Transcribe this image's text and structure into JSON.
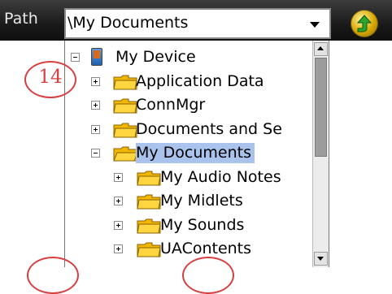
{
  "topbar": {
    "path_label": "Path",
    "path_value": "\\My Documents",
    "up_icon": "folder-up-icon"
  },
  "tree": {
    "items": [
      {
        "label": "My Device",
        "level": 0,
        "expander": "minus",
        "icon": "device-icon",
        "selected": false
      },
      {
        "label": "Application Data",
        "level": 1,
        "expander": "plus",
        "icon": "folder-icon",
        "selected": false
      },
      {
        "label": "ConnMgr",
        "level": 1,
        "expander": "plus",
        "icon": "folder-icon",
        "selected": false
      },
      {
        "label": "Documents and Se",
        "level": 1,
        "expander": "plus",
        "icon": "folder-icon",
        "selected": false
      },
      {
        "label": "My Documents",
        "level": 1,
        "expander": "minus",
        "icon": "folder-open-icon",
        "selected": true
      },
      {
        "label": "My Audio Notes",
        "level": 2,
        "expander": "plus",
        "icon": "folder-icon",
        "selected": false
      },
      {
        "label": "My Midlets",
        "level": 2,
        "expander": "plus",
        "icon": "folder-icon",
        "selected": false
      },
      {
        "label": "My Sounds",
        "level": 2,
        "expander": "plus",
        "icon": "folder-icon",
        "selected": false
      },
      {
        "label": "UAContents",
        "level": 2,
        "expander": "plus",
        "icon": "folder-icon",
        "selected": false
      }
    ]
  },
  "annotations": {
    "callout_14": "14"
  },
  "colors": {
    "selection": "#a9c3ec",
    "callout": "#d64040",
    "folder": "#f2b800"
  }
}
